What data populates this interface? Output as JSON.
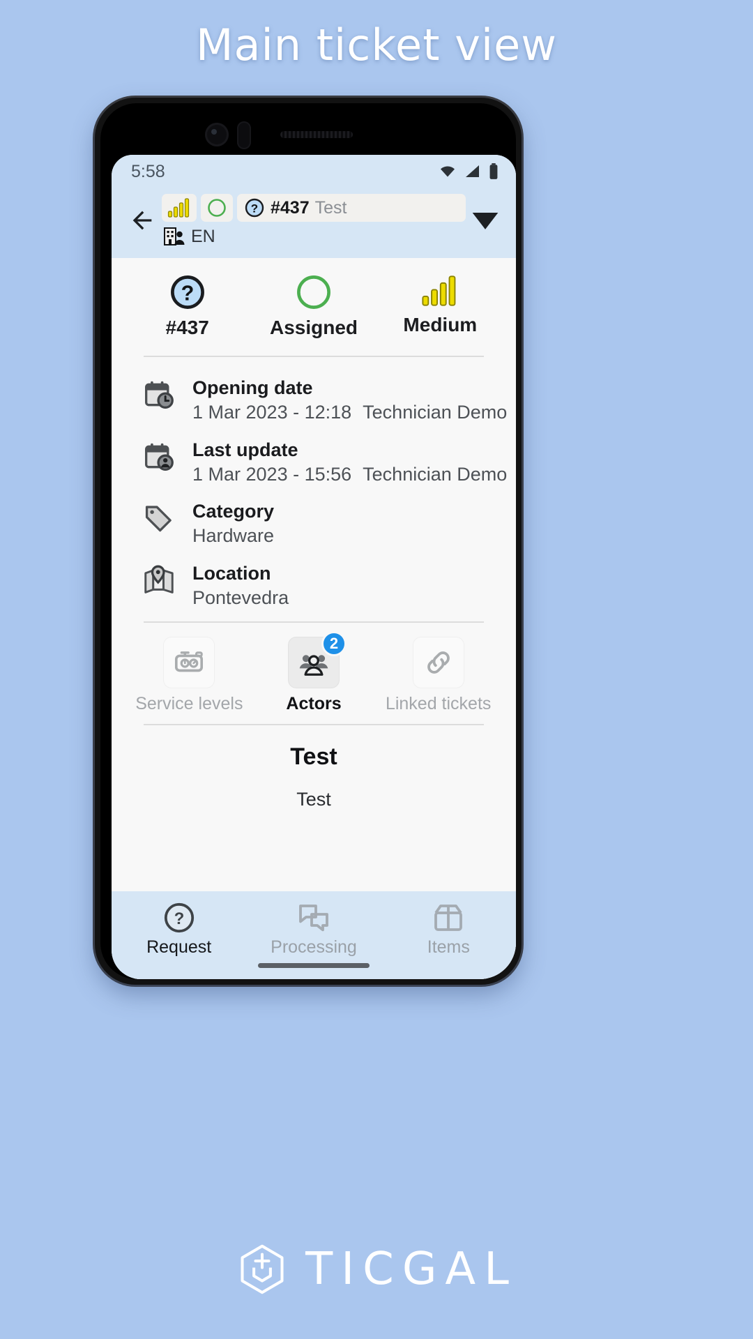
{
  "headline": "Main ticket view",
  "statusbar": {
    "time": "5:58",
    "icons": [
      "wifi-icon",
      "signal-icon",
      "battery-icon"
    ]
  },
  "appbar": {
    "back_icon": "back-arrow-icon",
    "priority_chip_icon": "priority-bars-icon",
    "status_chip_icon": "status-circle-icon",
    "ticket_icon": "question-mark-icon",
    "ticket_id": "#437",
    "ticket_title": "Test",
    "company_icon": "company-user-icon",
    "language": "EN",
    "expand_icon": "chevron-down-icon"
  },
  "summary": {
    "ticket": {
      "icon": "question-mark-circle-icon",
      "label": "#437"
    },
    "status": {
      "icon": "status-circle-icon",
      "label": "Assigned",
      "color": "#4caf50"
    },
    "priority": {
      "icon": "priority-bars-icon",
      "label": "Medium",
      "color": "#e0c900"
    }
  },
  "details": [
    {
      "icon": "calendar-clock-icon",
      "label": "Opening date",
      "value": "1 Mar 2023 - 12:18",
      "author": "Technician Demo"
    },
    {
      "icon": "calendar-user-icon",
      "label": "Last update",
      "value": "1 Mar 2023 - 15:56",
      "author": "Technician Demo"
    },
    {
      "icon": "tag-icon",
      "label": "Category",
      "value": "Hardware",
      "author": ""
    },
    {
      "icon": "map-pin-icon",
      "label": "Location",
      "value": "Pontevedra",
      "author": ""
    }
  ],
  "tabs": [
    {
      "icon": "stopwatch-icon",
      "label": "Service levels",
      "active": false,
      "badge": ""
    },
    {
      "icon": "people-group-icon",
      "label": "Actors",
      "active": true,
      "badge": "2"
    },
    {
      "icon": "link-chain-icon",
      "label": "Linked tickets",
      "active": false,
      "badge": ""
    }
  ],
  "content": {
    "title": "Test",
    "body": "Test"
  },
  "bottomnav": [
    {
      "icon": "question-mark-circle-icon",
      "label": "Request",
      "active": true
    },
    {
      "icon": "chat-bubbles-icon",
      "label": "Processing",
      "active": false
    },
    {
      "icon": "box-icon",
      "label": "Items",
      "active": false
    }
  ],
  "brand": {
    "logo_icon": "ticgal-logo-icon",
    "name": "TICGAL"
  },
  "colors": {
    "background": "#aac6ee",
    "appbar": "#d6e6f5",
    "accent_blue": "#1e90e8",
    "status_green": "#4caf50",
    "priority_yellow": "#e0c900"
  }
}
